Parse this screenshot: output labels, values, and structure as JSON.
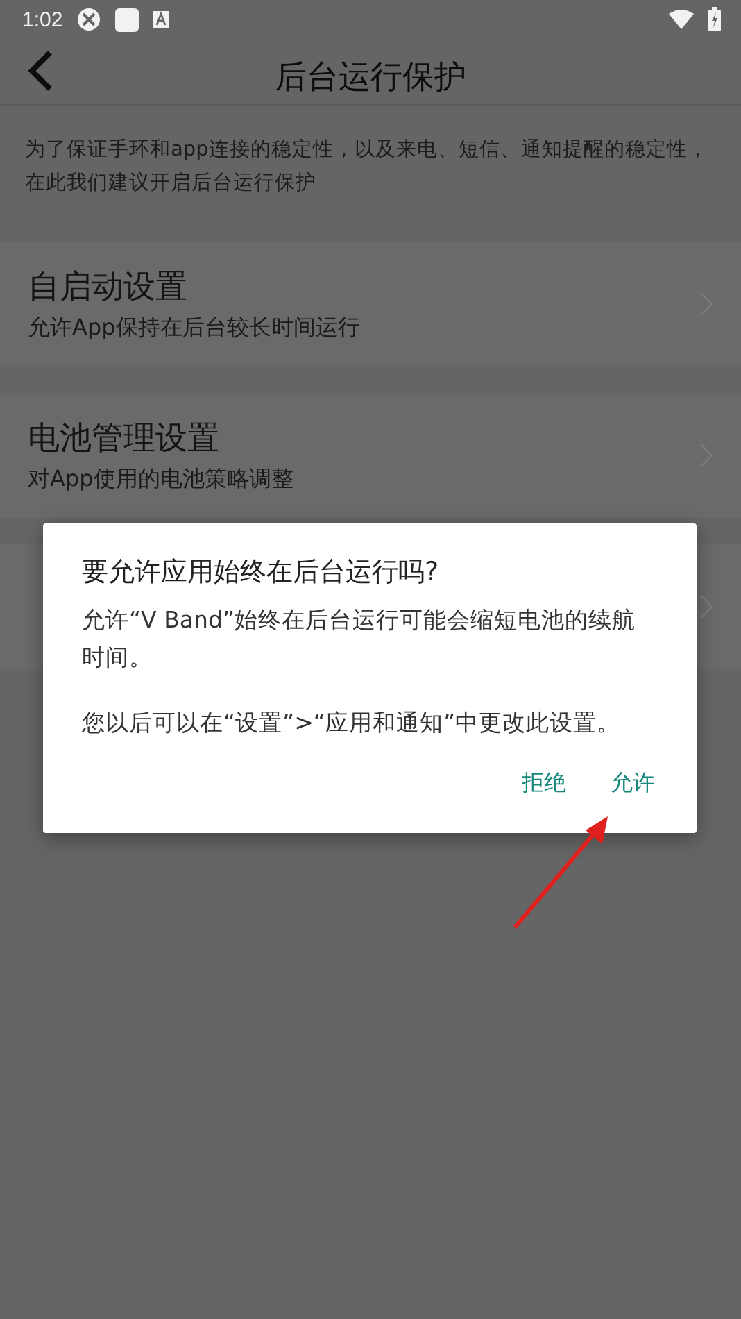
{
  "status_bar": {
    "time": "1:02"
  },
  "header": {
    "title": "后台运行保护"
  },
  "description": "为了保证手环和app连接的稳定性，以及来电、短信、通知提醒的稳定性，在此我们建议开启后台运行保护",
  "settings": [
    {
      "kind": "entry",
      "title": "自启动设置",
      "subtitle": "允许App保持在后台较长时间运行"
    },
    {
      "kind": "entry",
      "title": "电池管理设置",
      "subtitle": "对App使用的电池策略调整"
    },
    {
      "kind": "covered"
    }
  ],
  "dialog": {
    "title": "要允许应用始终在后台运行吗?",
    "message": "允许“V Band”始终在后台运行可能会缩短电池的续航时间。",
    "note": "您以后可以在“设置”>“应用和通知”中更改此设置。",
    "buttons": [
      {
        "label": "拒绝"
      },
      {
        "label": "允许"
      }
    ]
  }
}
